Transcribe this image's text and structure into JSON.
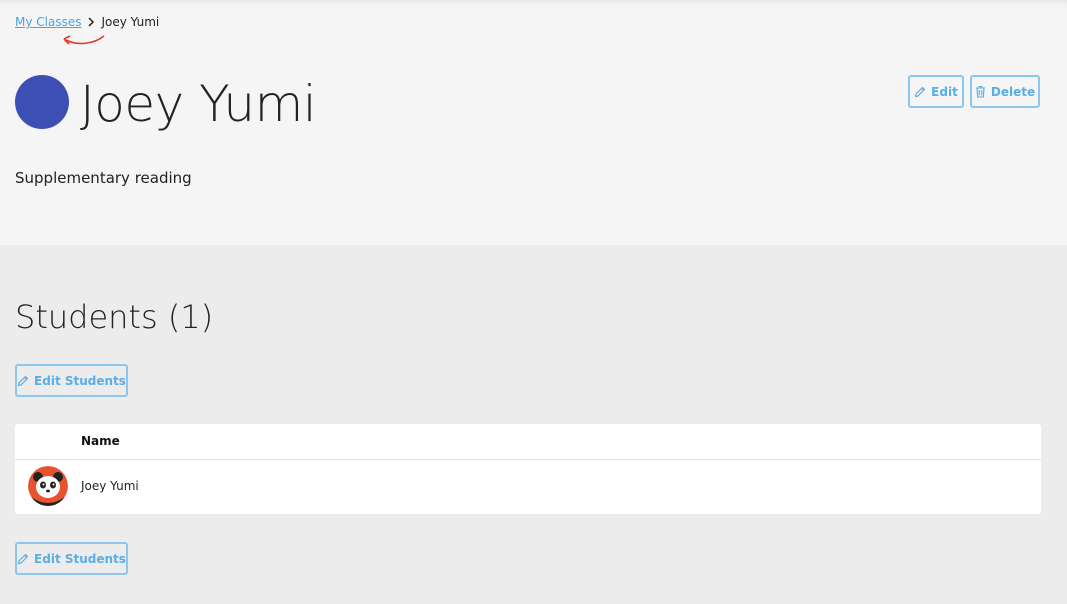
{
  "breadcrumb": {
    "parent": "My Classes",
    "current": "Joey Yumi"
  },
  "class": {
    "name": "Joey Yumi",
    "description": "Supplementary reading",
    "color": "#3d4fb5"
  },
  "actions": {
    "edit_label": "Edit",
    "delete_label": "Delete"
  },
  "students": {
    "heading": "Students (1)",
    "edit_students_label": "Edit Students",
    "table": {
      "columns": [
        "Name"
      ],
      "rows": [
        {
          "name": "Joey Yumi",
          "avatar": "panda-avatar"
        }
      ]
    }
  },
  "colors": {
    "accent": "#5aaee4",
    "annotation": "#e03a2a"
  }
}
